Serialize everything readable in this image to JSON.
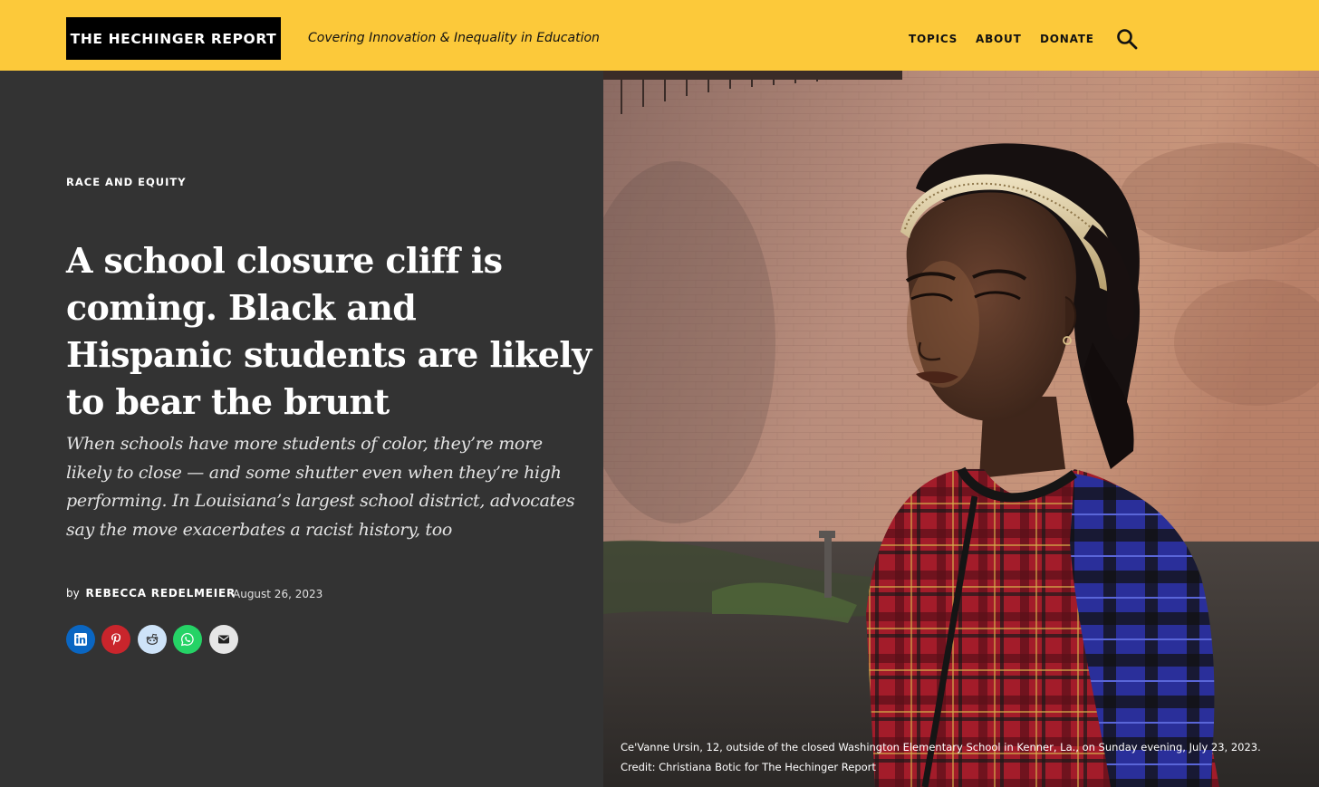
{
  "header": {
    "logo": "THE HECHINGER REPORT",
    "tagline": "Covering Innovation & Inequality in Education",
    "nav": [
      "TOPICS",
      "ABOUT",
      "DONATE"
    ],
    "search_icon": "search-icon",
    "background_color": "#fcc93a"
  },
  "article": {
    "category": "RACE AND EQUITY",
    "headline": "A school closure cliff is coming. Black and Hispanic students are likely to bear the brunt",
    "dek": "When schools have more students of color, they’re more likely to close — and some shutter even when they’re high performing. In Louisiana’s largest school district, advocates say the move exacerbates a racist history, too",
    "by": "by",
    "author": "REBECCA REDELMEIER",
    "date": "August 26, 2023",
    "panel_color": "#333333"
  },
  "share": [
    {
      "name": "linkedin",
      "icon": "linkedin-icon",
      "color": "#0a66c2"
    },
    {
      "name": "pinterest",
      "icon": "pinterest-icon",
      "color": "#c9252c"
    },
    {
      "name": "reddit",
      "icon": "reddit-icon",
      "color": "#cee3f8"
    },
    {
      "name": "whatsapp",
      "icon": "whatsapp-icon",
      "color": "#25d366"
    },
    {
      "name": "email",
      "icon": "email-icon",
      "color": "#e6e6e6"
    }
  ],
  "photo": {
    "caption": "Ce'Vanne Ursin, 12, outside of the closed Washington Elementary School in Kenner, La., on Sunday evening, July 23, 2023. Credit: Christiana Botic for The Hechinger Report"
  }
}
